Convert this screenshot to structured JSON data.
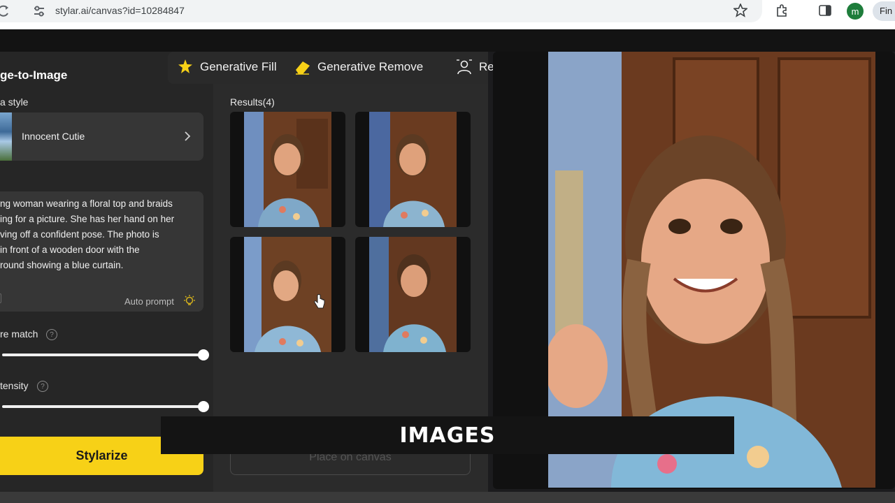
{
  "browser": {
    "url": "stylar.ai/canvas?id=10284847",
    "profile_initial": "m",
    "truncated_button": "Fin"
  },
  "toolbar": {
    "items": [
      {
        "label": "Generative Fill",
        "icon": "star-wand-icon"
      },
      {
        "label": "Generative Remove",
        "icon": "eraser-icon"
      },
      {
        "label": "Re",
        "icon": "person-cutout-icon"
      }
    ]
  },
  "sidebar": {
    "title": "ge-to-Image",
    "style_section_label": "a style",
    "style_name": "Innocent Cutie",
    "prompt": [
      "ng woman wearing a floral top and braids",
      "ing for a picture. She has her hand on her",
      "ving off a confident pose. The photo is",
      " in front of a wooden door with the",
      "round showing a blue curtain."
    ],
    "auto_prompt_label": "Auto prompt",
    "sliders": [
      {
        "label": "re match",
        "value": 1.0
      },
      {
        "label": "tensity",
        "value": 1.0
      }
    ],
    "primary_button": "Stylarize"
  },
  "results": {
    "label": "Results(4)",
    "place_button": "Place on canvas"
  },
  "caption": {
    "text": "IMAGES"
  },
  "colors": {
    "accent_yellow": "#f7d117",
    "panel_dark": "#262626",
    "card": "#363636"
  }
}
